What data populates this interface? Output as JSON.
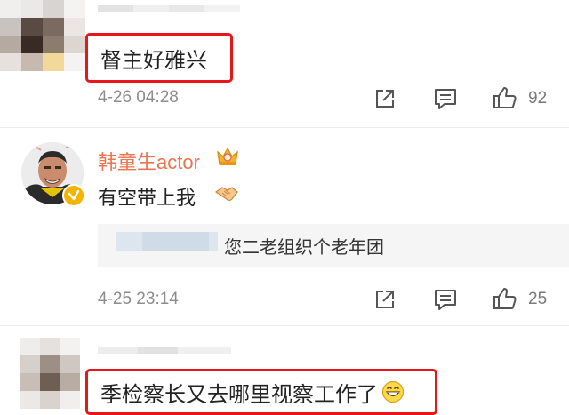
{
  "comments": [
    {
      "text": "督主好雅兴",
      "timestamp": "4-26 04:28",
      "like_count": "92",
      "highlighted": true
    },
    {
      "username": "韩童生actor",
      "text": "有空带上我",
      "quote_text": "您二老组织个老年团",
      "timestamp": "4-25 23:14",
      "like_count": "25",
      "verified": true
    },
    {
      "text": "季检察长又去哪里视察工作了",
      "highlighted": true
    }
  ],
  "icons": {
    "share": "share-icon",
    "comment": "comment-icon",
    "like": "like-icon",
    "badge": "crown-badge-icon",
    "handshake": "handshake-emoji-icon",
    "grin": "grin-emoji-icon",
    "verified": "verified-badge-icon"
  },
  "colors": {
    "highlight": "#e8151b",
    "username": "#eb7350",
    "meta": "#8c8c8c",
    "verified": "#f4b400"
  }
}
